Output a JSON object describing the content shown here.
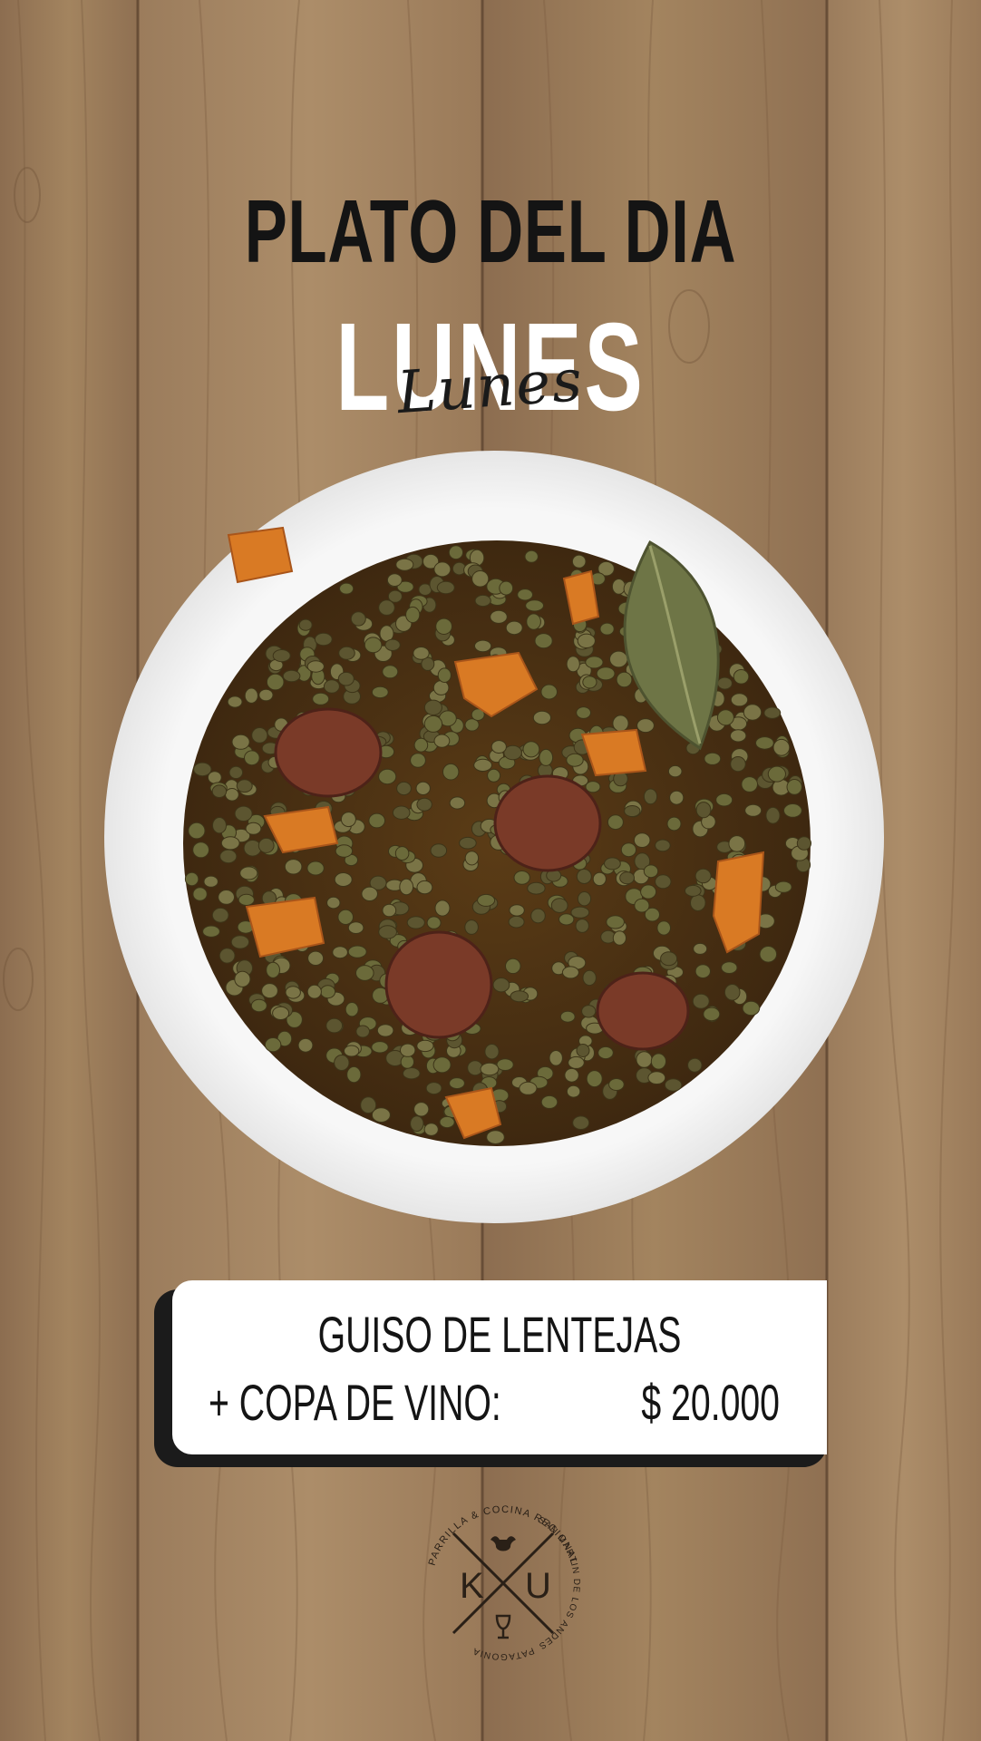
{
  "header": {
    "title": "PLATO DEL DIA",
    "day": "LUNES",
    "day_script": "Lunes"
  },
  "dish": {
    "name": "GUISO DE LENTEJAS",
    "extra": "+ COPA DE VINO:",
    "price": "$ 20.000"
  },
  "logo": {
    "letters_left": "K",
    "letters_right": "U",
    "ring_text_top": "PARRILLA & COCINA REGIONAL",
    "ring_text_right": "SAN MARTIN DE LOS ANDES",
    "ring_text_bottom": "PATAGONIA"
  },
  "colors": {
    "wood": "#9a7a5a",
    "title_dark": "#141414",
    "title_light": "#ffffff",
    "card": "#ffffff",
    "card_shadow": "#1b1b1b"
  }
}
